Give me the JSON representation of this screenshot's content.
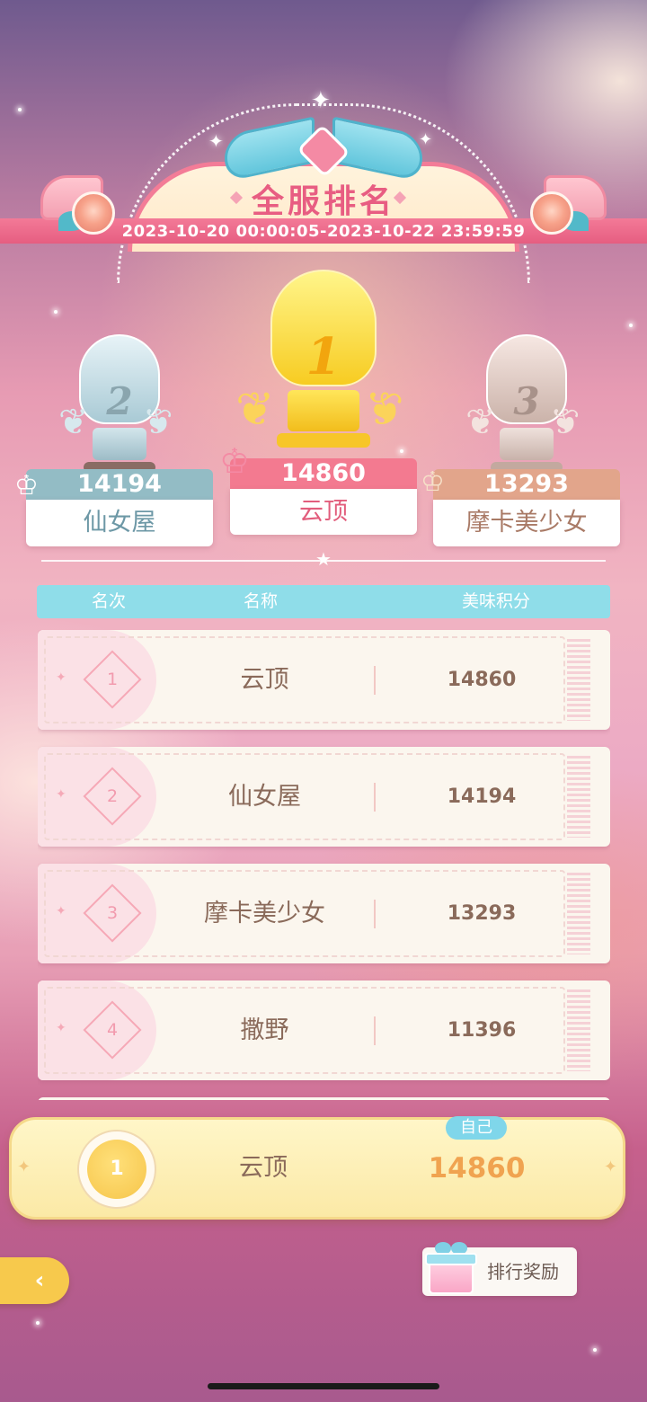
{
  "header": {
    "title": "全服排名",
    "date_range": "2023-10-20 00:00:05-2023-10-22 23:59:59"
  },
  "podium": {
    "first": {
      "rank": "1",
      "score": "14860",
      "name": "云顶"
    },
    "second": {
      "rank": "2",
      "score": "14194",
      "name": "仙女屋"
    },
    "third": {
      "rank": "3",
      "score": "13293",
      "name": "摩卡美少女"
    }
  },
  "table": {
    "columns": {
      "rank": "名次",
      "name": "名称",
      "score": "美味积分"
    },
    "rows": [
      {
        "rank": "1",
        "name": "云顶",
        "score": "14860"
      },
      {
        "rank": "2",
        "name": "仙女屋",
        "score": "14194"
      },
      {
        "rank": "3",
        "name": "摩卡美少女",
        "score": "13293"
      },
      {
        "rank": "4",
        "name": "撒野",
        "score": "11396"
      }
    ]
  },
  "self": {
    "tag": "自己",
    "rank": "1",
    "name": "云顶",
    "score": "14860"
  },
  "buttons": {
    "reward_label": "排行奖励",
    "back_icon": "back-arrow-icon",
    "reward_icon": "gift-icon"
  },
  "colors": {
    "pink_accent": "#e85d82",
    "table_header": "#8fdde9",
    "gold_score": "#f0a350",
    "first_bar": "#f37a90",
    "second_bar": "#93bcc5",
    "third_bar": "#e2a58b"
  }
}
